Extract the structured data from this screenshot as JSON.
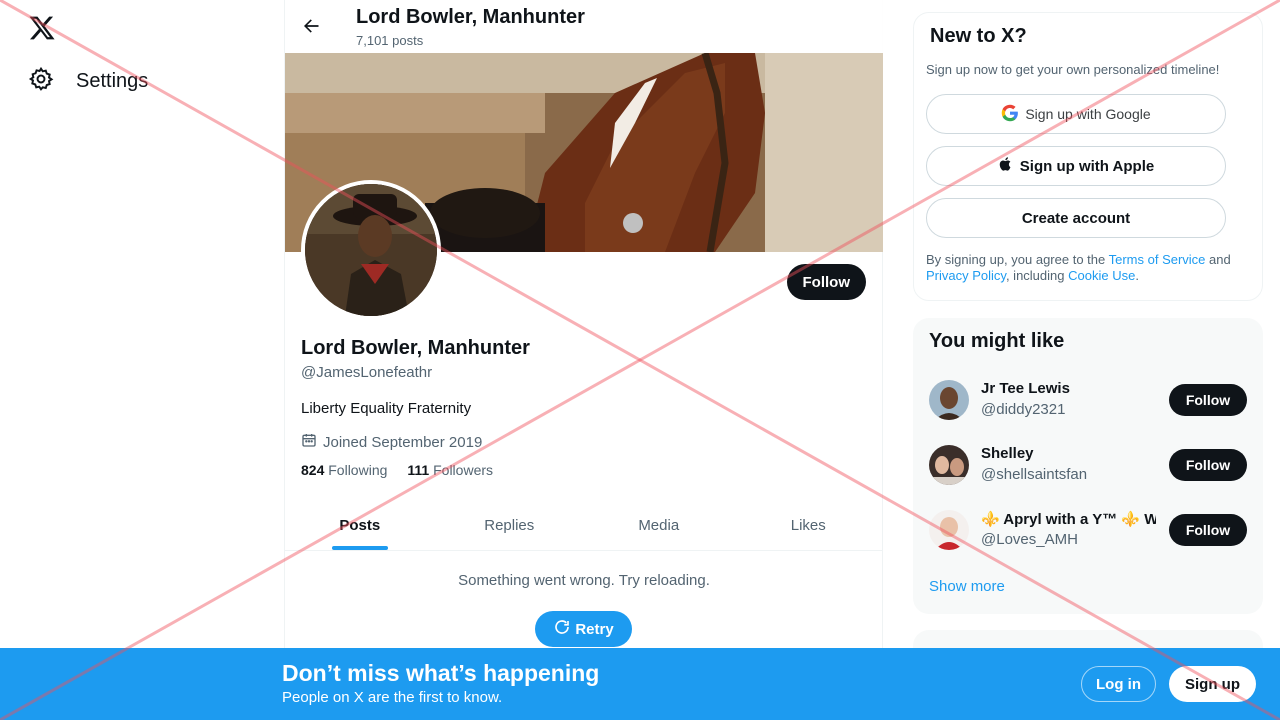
{
  "nav": {
    "logo_icon": "x-logo-icon",
    "settings_label": "Settings"
  },
  "profile_header": {
    "title": "Lord Bowler, Manhunter",
    "post_count": "7,101 posts"
  },
  "profile": {
    "name": "Lord Bowler, Manhunter",
    "handle": "@JamesLonefeathr",
    "bio": "Liberty Equality Fraternity",
    "joined": "Joined September 2019",
    "following_count": "824",
    "following_label": "Following",
    "followers_count": "111",
    "followers_label": "Followers",
    "follow_label": "Follow"
  },
  "tabs": [
    {
      "label": "Posts",
      "active": true
    },
    {
      "label": "Replies",
      "active": false
    },
    {
      "label": "Media",
      "active": false
    },
    {
      "label": "Likes",
      "active": false
    }
  ],
  "error": {
    "message": "Something went wrong. Try reloading.",
    "retry_label": "Retry"
  },
  "new_to_x": {
    "title": "New to X?",
    "subtitle": "Sign up now to get your own personalized timeline!",
    "google_label": "Sign up with Google",
    "apple_label": "Sign up with Apple",
    "create_label": "Create account",
    "legal_prefix": "By signing up, you agree to the ",
    "terms": "Terms of Service",
    "legal_and": " and ",
    "privacy": "Privacy Policy",
    "legal_including": ", including ",
    "cookie": "Cookie Use",
    "legal_end": "."
  },
  "you_might_like": {
    "title": "You might like",
    "users": [
      {
        "name": "Jr Tee Lewis",
        "handle": "@diddy2321",
        "follow": "Follow"
      },
      {
        "name": "Shelley",
        "handle": "@shellsaintsfan",
        "follow": "Follow"
      },
      {
        "name": "⚜️ Apryl with a Y™ ⚜️ W",
        "handle": "@Loves_AMH",
        "follow": "Follow"
      }
    ],
    "show_more": "Show more"
  },
  "bottom_bar": {
    "title": "Don’t miss what’s happening",
    "subtitle": "People on X are the first to know.",
    "login_label": "Log in",
    "signup_label": "Sign up"
  },
  "colors": {
    "accent": "#1d9bf0",
    "dark": "#0f1419",
    "muted": "#536471"
  }
}
